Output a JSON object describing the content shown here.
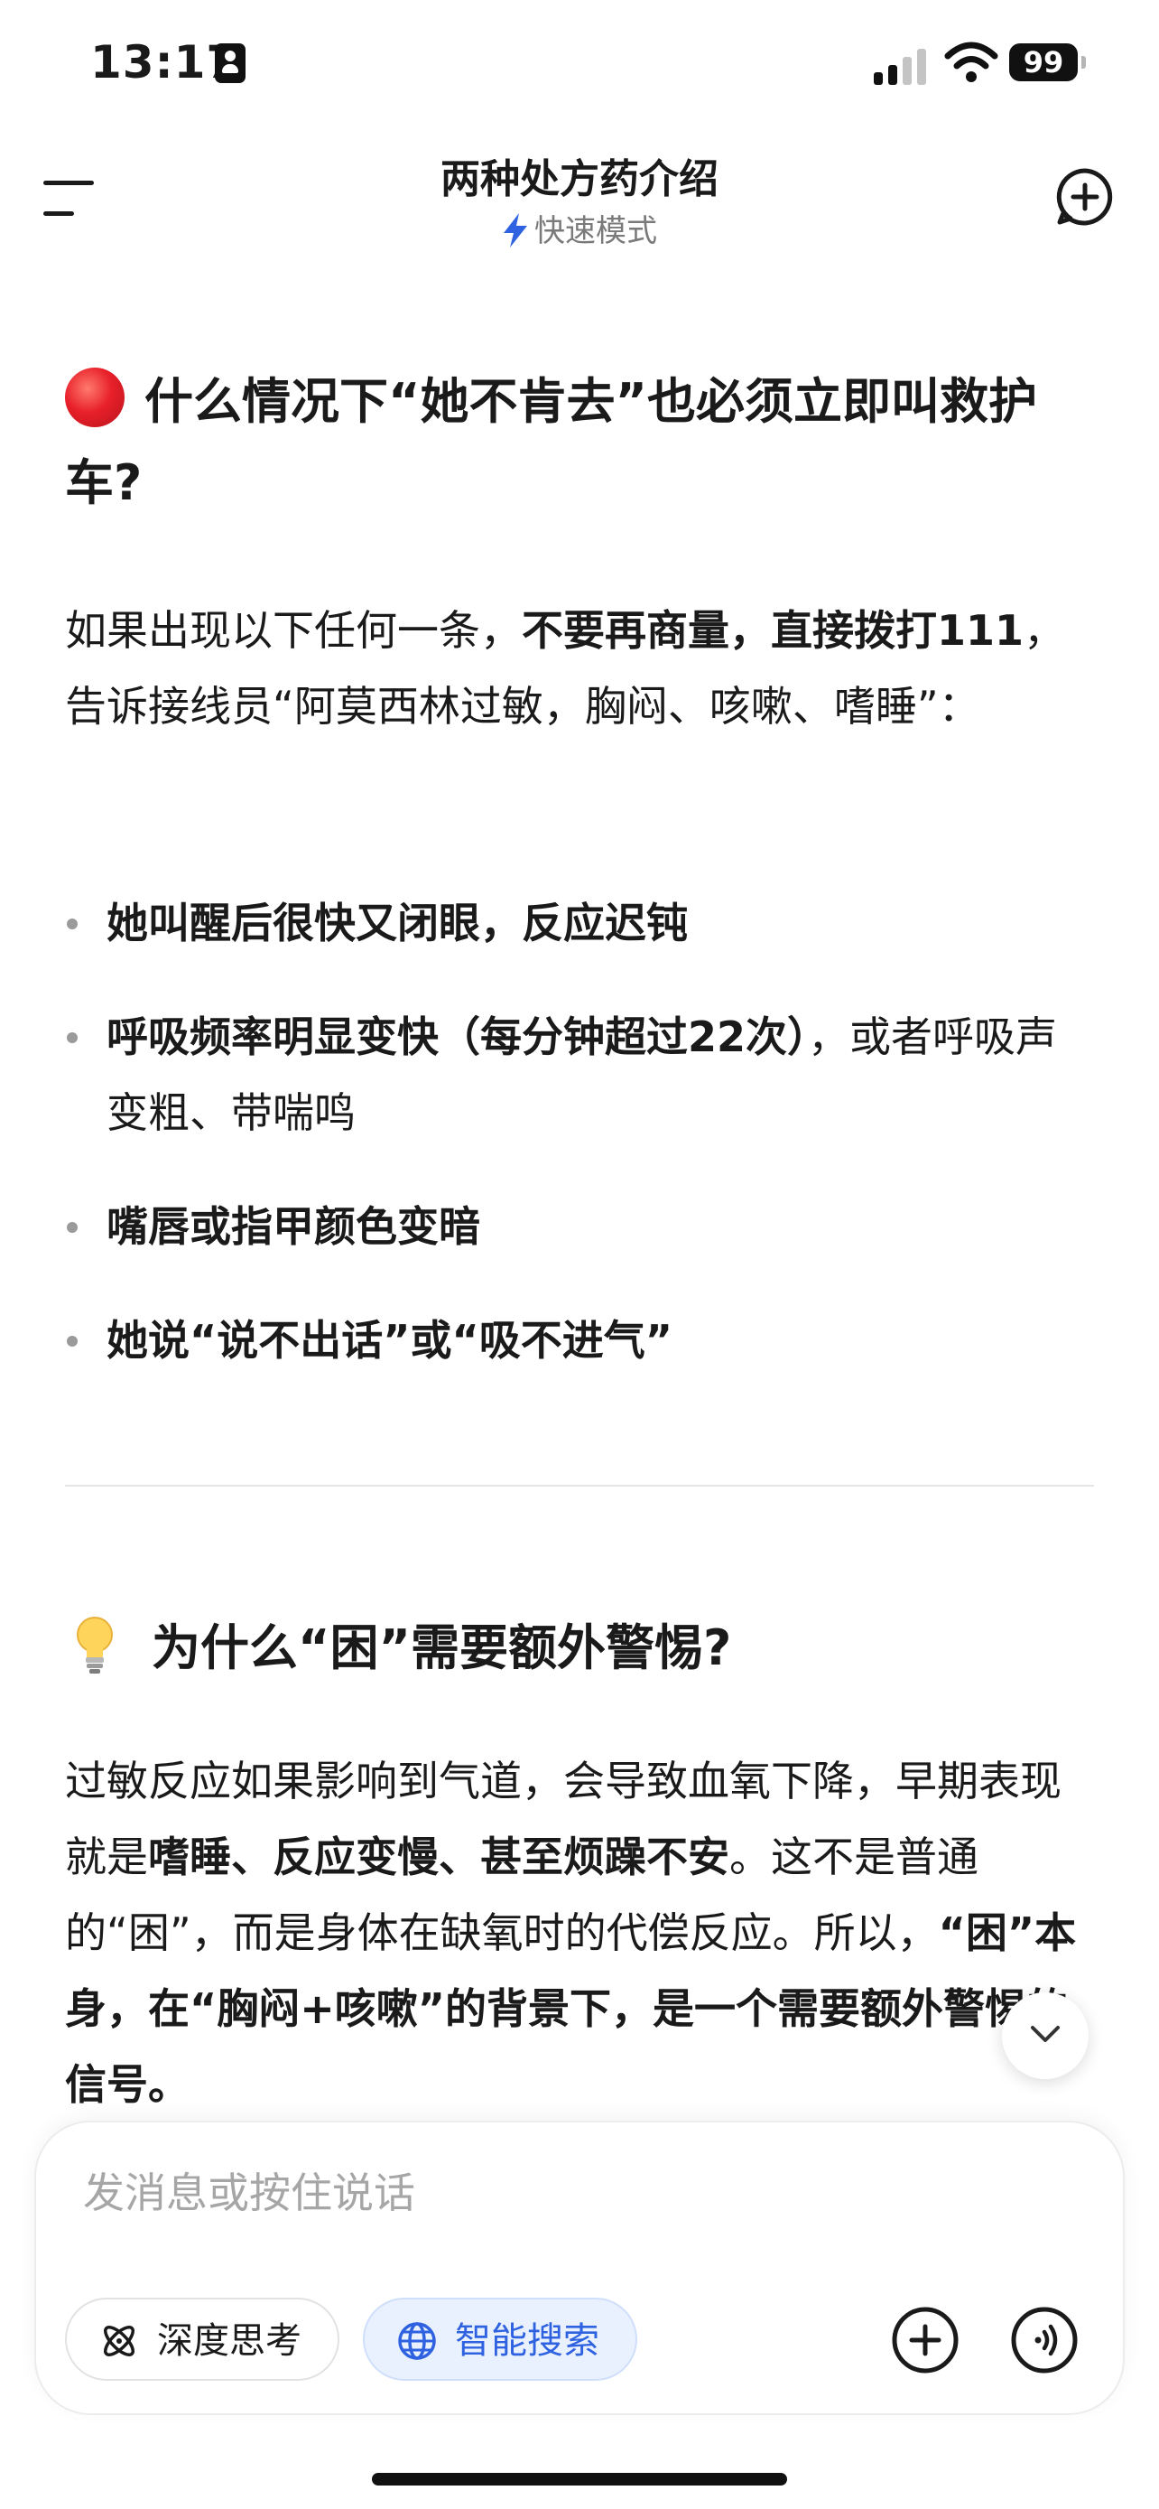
{
  "status_bar": {
    "time": "13:17",
    "battery": "99"
  },
  "header": {
    "title": "两种处方药介绍",
    "mode": "快速模式"
  },
  "section1": {
    "title": "什么情况下“她不肯去”也必须立即叫救护车?",
    "intro": {
      "p1": "如果出现以下任何一条，",
      "b1": "不要再商量，直接拨打111",
      "p2": "，告诉接线员“阿莫西林过敏，胸闷、咳嗽、嗜睡”："
    },
    "bullets": [
      {
        "bold": "她叫醒后很快又闭眼，反应迟钝",
        "rest": ""
      },
      {
        "bold": "呼吸频率明显变快（每分钟超过22次）",
        "rest": "，或者呼吸声变粗、带喘鸣"
      },
      {
        "bold": "嘴唇或指甲颜色变暗",
        "rest": ""
      },
      {
        "bold": "她说“说不出话”或“吸不进气”",
        "rest": ""
      }
    ]
  },
  "section2": {
    "title": "为什么“困”需要额外警惕?",
    "body": {
      "p1": "过敏反应如果影响到气道，会导致血氧下降，早期表现就是",
      "b1": "嗜睡、反应变慢、甚至烦躁不安",
      "p2": "。这不是普通的“困”，而是身体在缺氧时的代偿反应。所以，",
      "b2": "“困”本身，在“胸闷+咳嗽”的背景下，是一个需要额外警惕的信号。"
    }
  },
  "composer": {
    "placeholder": "发消息或按住说话",
    "deep_think_label": "深度思考",
    "smart_search_label": "智能搜索"
  },
  "colors": {
    "accent": "#2e62e0",
    "alert_red": "#e8202a"
  }
}
